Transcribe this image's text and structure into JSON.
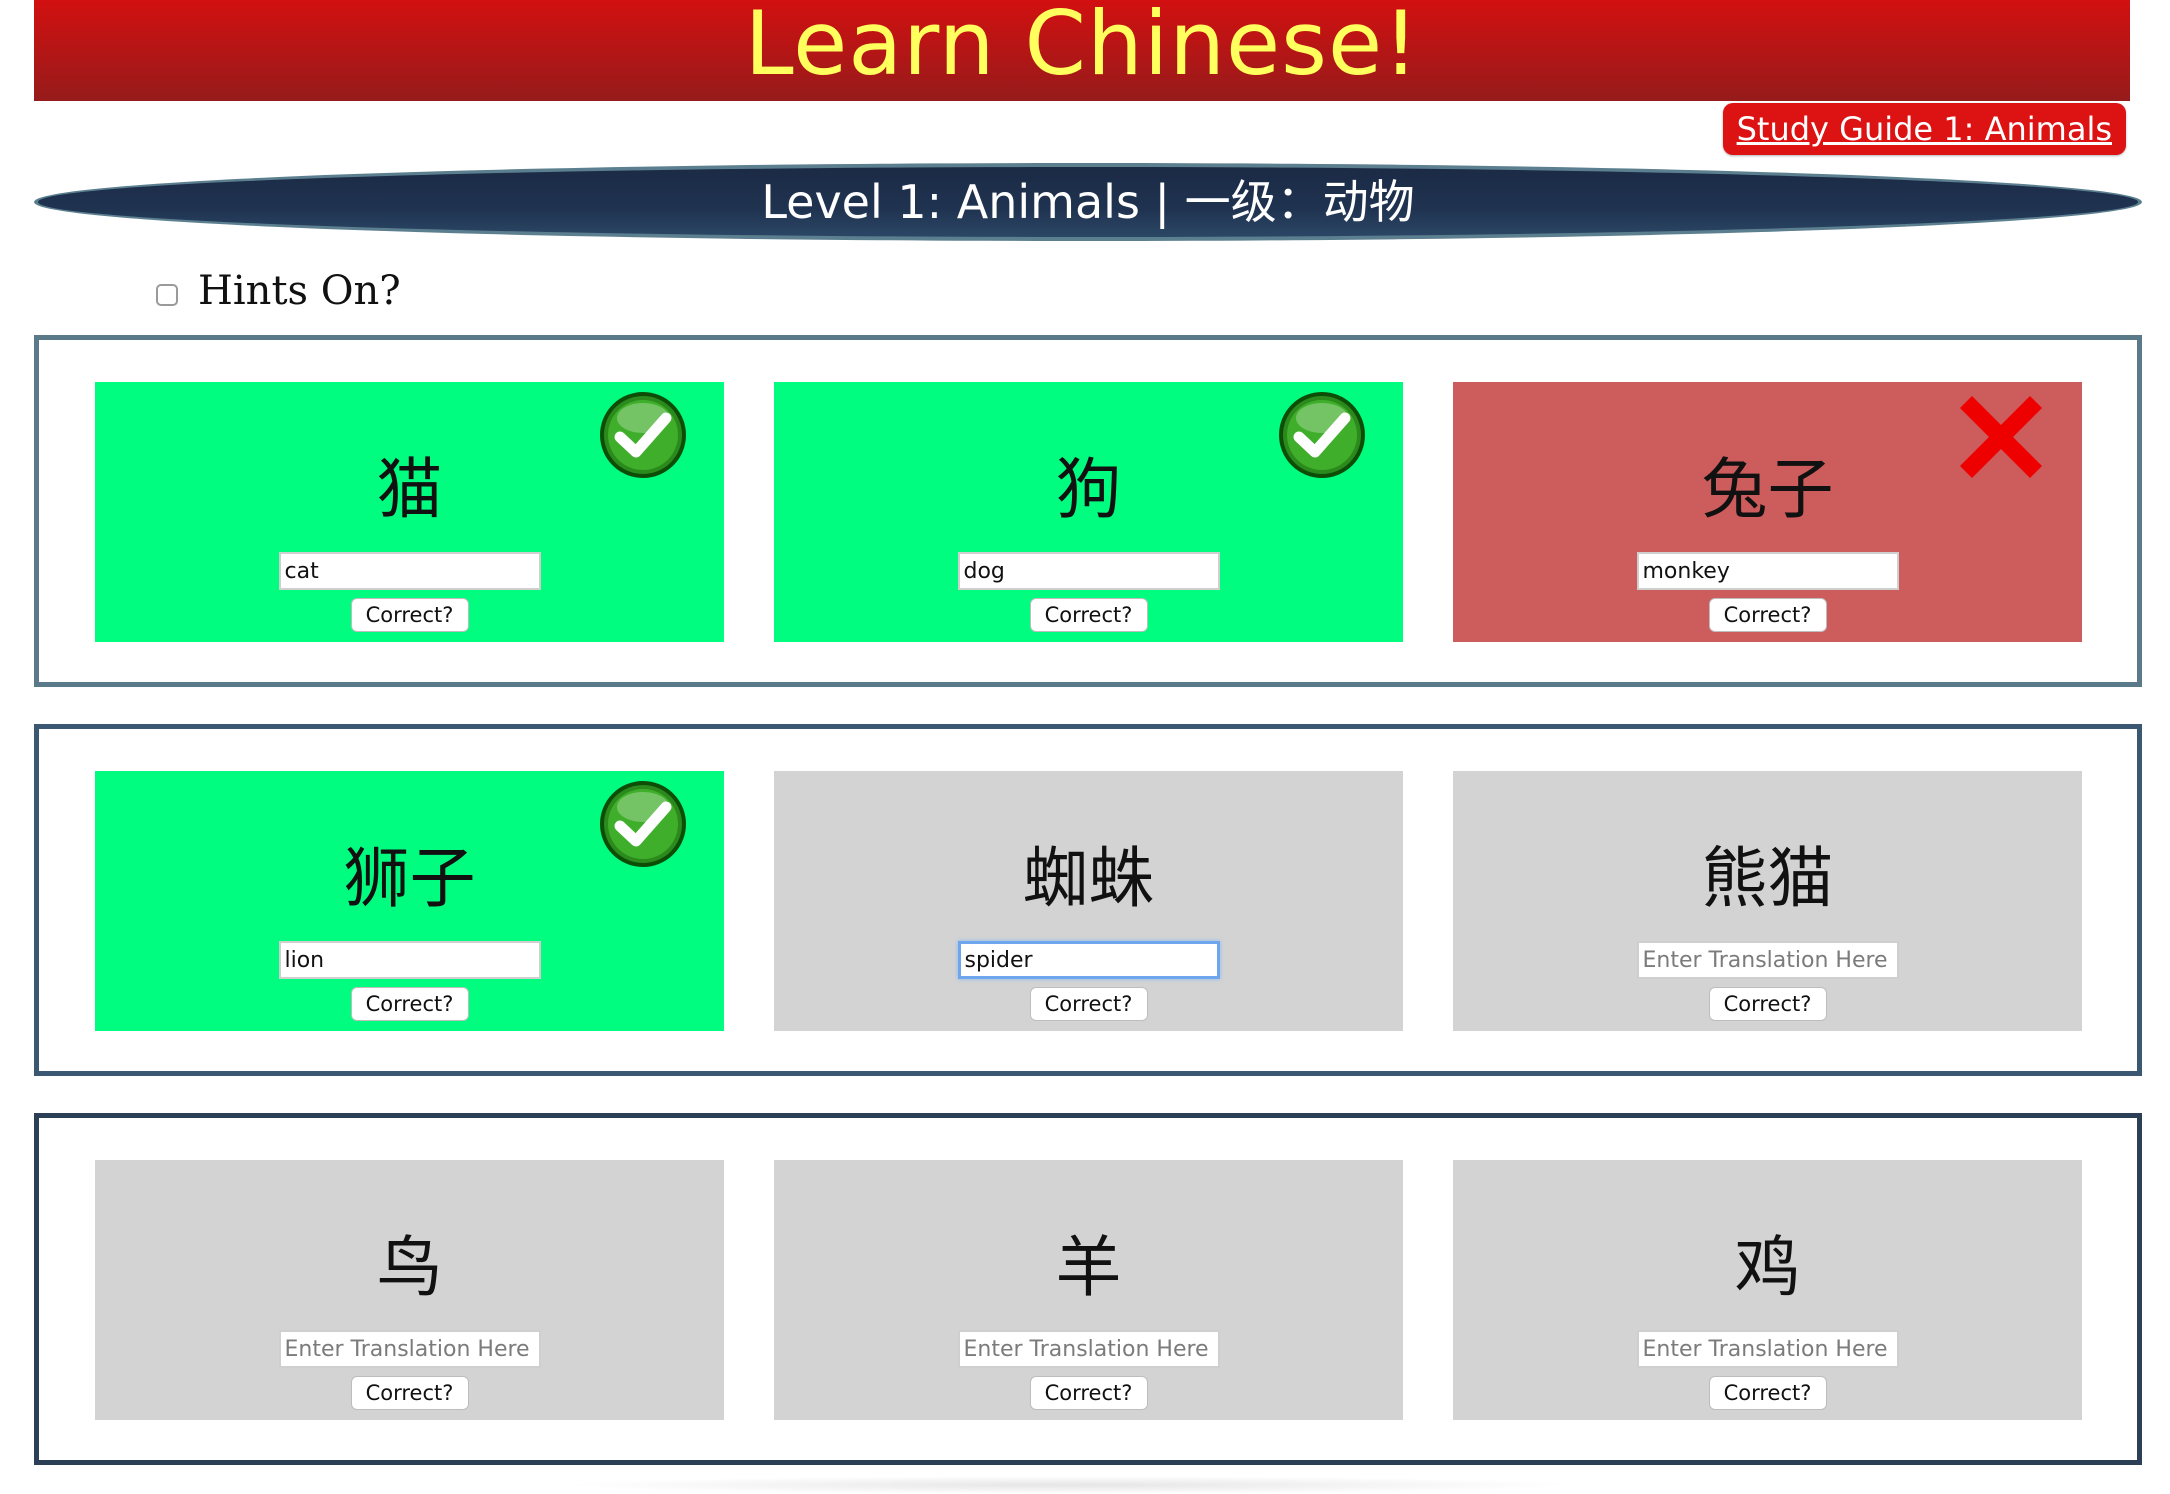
{
  "header": {
    "title": "Learn Chinese!"
  },
  "study_guide": {
    "label": "Study Guide 1: Animals"
  },
  "level": {
    "title": "Level 1: Animals | 一级：动物"
  },
  "hints": {
    "label": "Hints On?",
    "checked": false
  },
  "colors": {
    "header_red": "#b21616",
    "title_yellow": "#ffff5e",
    "correct_green": "#00fd80",
    "wrong_red": "#cd5c5c",
    "neutral_gray": "#d3d3d3",
    "level_navy": "#1f3350"
  },
  "placeholder": "Enter Translation Here",
  "check_label": "Correct?",
  "rows": [
    {
      "cards": [
        {
          "hanzi": "猫",
          "value": "cat",
          "status": "correct",
          "icon": "checkmark-icon"
        },
        {
          "hanzi": "狗",
          "value": "dog",
          "status": "correct",
          "icon": "checkmark-icon"
        },
        {
          "hanzi": "兔子",
          "value": "monkey",
          "status": "wrong",
          "icon": "x-mark-icon"
        }
      ]
    },
    {
      "cards": [
        {
          "hanzi": "狮子",
          "value": "lion",
          "status": "correct",
          "icon": "checkmark-icon"
        },
        {
          "hanzi": "蜘蛛",
          "value": "spider",
          "status": "neutral",
          "icon": ""
        },
        {
          "hanzi": "熊猫",
          "value": "",
          "status": "neutral",
          "icon": ""
        }
      ]
    },
    {
      "cards": [
        {
          "hanzi": "鸟",
          "value": "",
          "status": "neutral",
          "icon": ""
        },
        {
          "hanzi": "羊",
          "value": "",
          "status": "neutral",
          "icon": ""
        },
        {
          "hanzi": "鸡",
          "value": "",
          "status": "neutral",
          "icon": ""
        }
      ]
    }
  ]
}
